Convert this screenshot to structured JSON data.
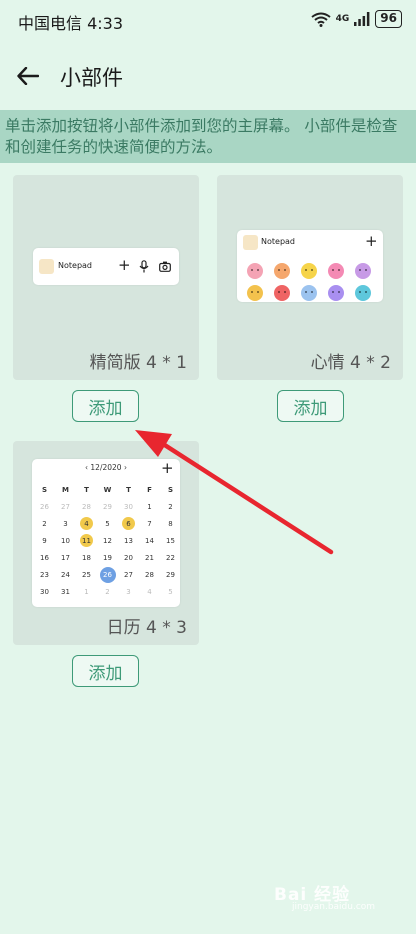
{
  "status_bar": {
    "carrier_time": "中国电信 4:33",
    "network": "4G",
    "battery": "96"
  },
  "top_bar": {
    "title": "小部件"
  },
  "banner": {
    "text": "单击添加按钮将小部件添加到您的主屏幕。 小部件是检查和创建任务的快速简便的方法。"
  },
  "widgets": {
    "simple": {
      "label": "精简版 4 * 1",
      "app_name": "Notepad",
      "add_label": "添加"
    },
    "mood": {
      "label": "心情 4 * 2",
      "app_name": "Notepad",
      "add_label": "添加"
    },
    "calendar": {
      "label": "日历 4 * 3",
      "month": "12/2020",
      "add_label": "添加",
      "weekdays": [
        "S",
        "M",
        "T",
        "W",
        "T",
        "F",
        "S"
      ],
      "days": [
        [
          "26",
          "27",
          "28",
          "29",
          "30",
          "1",
          "2"
        ],
        [
          "2",
          "3",
          "4",
          "5",
          "6",
          "7",
          "8"
        ],
        [
          "9",
          "10",
          "11",
          "12",
          "13",
          "14",
          "15"
        ],
        [
          "16",
          "17",
          "18",
          "19",
          "20",
          "21",
          "22"
        ],
        [
          "23",
          "24",
          "25",
          "26",
          "27",
          "28",
          "29"
        ],
        [
          "30",
          "31",
          "1",
          "2",
          "3",
          "4",
          "5"
        ]
      ]
    }
  },
  "emoji_colors": [
    "#f4a3b4",
    "#f5a76d",
    "#f6d44a",
    "#f48ab4",
    "#c79ae6",
    "#f3c24d",
    "#ef6464",
    "#9cc3ef",
    "#a98ff0",
    "#5ec7dc"
  ],
  "colors": {
    "background": "#e3f6eb",
    "banner": "#a9d6c4",
    "accent": "#3e9a78",
    "arrow": "#e8262f"
  },
  "watermark": {
    "text": "Bai 经验",
    "sub": "jingyan.baidu.com"
  }
}
